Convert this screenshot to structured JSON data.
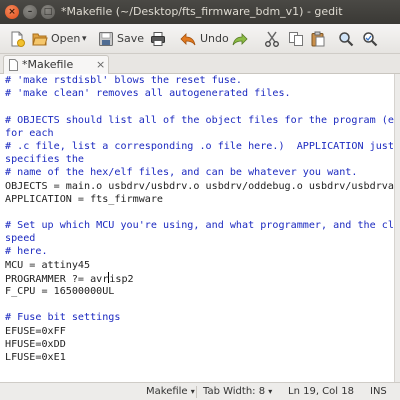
{
  "window": {
    "title": "*Makefile (~/Desktop/fts_firmware_bdm_v1) - gedit",
    "close_glyph": "×",
    "min_glyph": "–",
    "max_glyph": "□"
  },
  "toolbar": {
    "new_icon": "new-document-icon",
    "open_label": "Open",
    "open_dropdown_glyph": "▾",
    "save_label": "Save",
    "print_icon": "printer-icon",
    "undo_label": "Undo",
    "redo_icon": "redo-icon",
    "cut_icon": "scissors-icon",
    "copy_icon": "copy-icon",
    "paste_icon": "paste-icon",
    "find_icon": "magnifier-icon",
    "replace_icon": "find-replace-icon"
  },
  "tabs": [
    {
      "label": "*Makefile",
      "close_glyph": "×"
    }
  ],
  "editor": {
    "lines": [
      {
        "text": "# 'make rstdisbl' blows the reset fuse.",
        "type": "comment"
      },
      {
        "text": "# 'make clean' removes all autogenerated files.",
        "type": "comment"
      },
      {
        "text": "",
        "type": "blank"
      },
      {
        "text": "# OBJECTS should list all of the object files for the program (e.g.",
        "type": "comment"
      },
      {
        "text": "for each",
        "type": "comment"
      },
      {
        "text": "# .c file, list a corresponding .o file here.)  APPLICATION just",
        "type": "comment"
      },
      {
        "text": "specifies the",
        "type": "comment"
      },
      {
        "text": "# name of the hex/elf files, and can be whatever you want.",
        "type": "comment"
      },
      {
        "text": "OBJECTS = main.o usbdrv/usbdrv.o usbdrv/oddebug.o usbdrv/usbdrvasm.o",
        "type": "code"
      },
      {
        "text": "APPLICATION = fts_firmware",
        "type": "code"
      },
      {
        "text": "",
        "type": "blank"
      },
      {
        "text": "# Set up which MCU you're using, and what programmer, and the clock",
        "type": "comment"
      },
      {
        "text": "speed",
        "type": "comment"
      },
      {
        "text": "# here.",
        "type": "comment"
      },
      {
        "text": "MCU = attiny45",
        "type": "code"
      },
      {
        "text_before_caret": "PROGRAMMER ?= avr",
        "text_after_caret": "isp2",
        "type": "caret"
      },
      {
        "text": "F_CPU = 16500000UL",
        "type": "code"
      },
      {
        "text": "",
        "type": "blank"
      },
      {
        "text": "# Fuse bit settings",
        "type": "comment"
      },
      {
        "text": "EFUSE=0xFF",
        "type": "code"
      },
      {
        "text": "HFUSE=0xDD",
        "type": "code"
      },
      {
        "text": "LFUSE=0xE1",
        "type": "code"
      }
    ]
  },
  "statusbar": {
    "language": "Makefile",
    "language_glyph": "▾",
    "tab_width": "Tab Width: 8",
    "tab_width_glyph": "▾",
    "position": "Ln 19, Col 18",
    "mode": "INS"
  },
  "colors": {
    "comment": "#1c2ac0",
    "titlebar": "#3c3b37",
    "close_button": "#df4a16"
  }
}
